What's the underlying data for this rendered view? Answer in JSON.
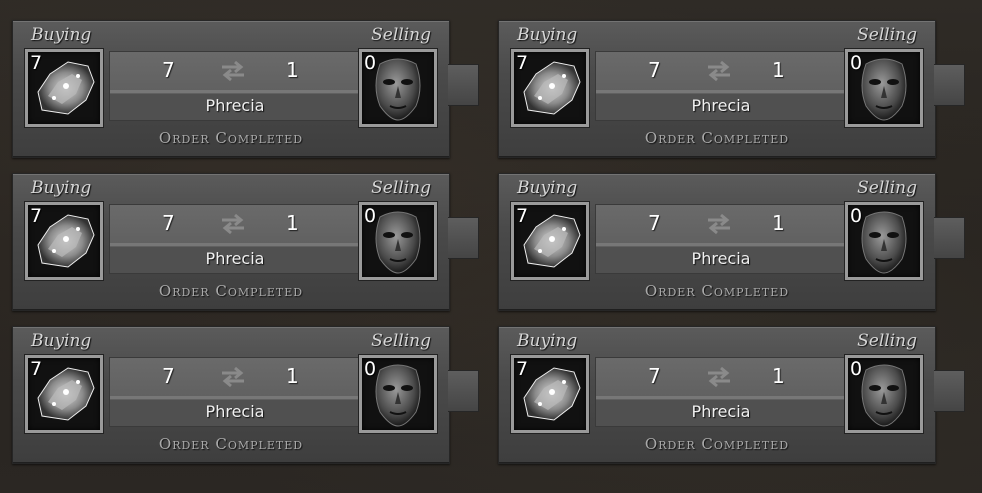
{
  "orders": [
    {
      "buying_label": "Buying",
      "selling_label": "Selling",
      "buy_qty": "7",
      "sell_qty": "0",
      "buy_amount": "7",
      "sell_amount": "1",
      "league": "Phrecia",
      "status": "Order Completed",
      "buy_item_icon": "crystal-fossil-icon",
      "sell_item_icon": "mask-icon"
    },
    {
      "buying_label": "Buying",
      "selling_label": "Selling",
      "buy_qty": "7",
      "sell_qty": "0",
      "buy_amount": "7",
      "sell_amount": "1",
      "league": "Phrecia",
      "status": "Order Completed",
      "buy_item_icon": "crystal-fossil-icon",
      "sell_item_icon": "mask-icon"
    },
    {
      "buying_label": "Buying",
      "selling_label": "Selling",
      "buy_qty": "7",
      "sell_qty": "0",
      "buy_amount": "7",
      "sell_amount": "1",
      "league": "Phrecia",
      "status": "Order Completed",
      "buy_item_icon": "crystal-fossil-icon",
      "sell_item_icon": "mask-icon"
    },
    {
      "buying_label": "Buying",
      "selling_label": "Selling",
      "buy_qty": "7",
      "sell_qty": "0",
      "buy_amount": "7",
      "sell_amount": "1",
      "league": "Phrecia",
      "status": "Order Completed",
      "buy_item_icon": "crystal-fossil-icon",
      "sell_item_icon": "mask-icon"
    },
    {
      "buying_label": "Buying",
      "selling_label": "Selling",
      "buy_qty": "7",
      "sell_qty": "0",
      "buy_amount": "7",
      "sell_amount": "1",
      "league": "Phrecia",
      "status": "Order Completed",
      "buy_item_icon": "crystal-fossil-icon",
      "sell_item_icon": "mask-icon"
    },
    {
      "buying_label": "Buying",
      "selling_label": "Selling",
      "buy_qty": "7",
      "sell_qty": "0",
      "buy_amount": "7",
      "sell_amount": "1",
      "league": "Phrecia",
      "status": "Order Completed",
      "buy_item_icon": "crystal-fossil-icon",
      "sell_item_icon": "mask-icon"
    }
  ],
  "icons": {
    "swap": "swap-arrows-icon",
    "buy_item": "crystal-fossil-icon",
    "sell_item": "mask-icon"
  }
}
